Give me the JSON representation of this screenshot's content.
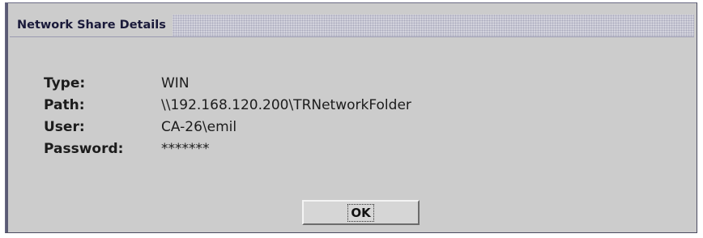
{
  "dialog": {
    "title": "Network Share Details",
    "fields": [
      {
        "label": "Type:",
        "value": "WIN"
      },
      {
        "label": "Path:",
        "value": "\\\\192.168.120.200\\TRNetworkFolder"
      },
      {
        "label": "User:",
        "value": "CA-26\\emil"
      },
      {
        "label": "Password:",
        "value": "*******"
      }
    ],
    "ok_label": "OK"
  },
  "colors": {
    "dialog_background": "#cccccc",
    "title_text": "#1a1a3a",
    "frame": "#5a5a74"
  }
}
